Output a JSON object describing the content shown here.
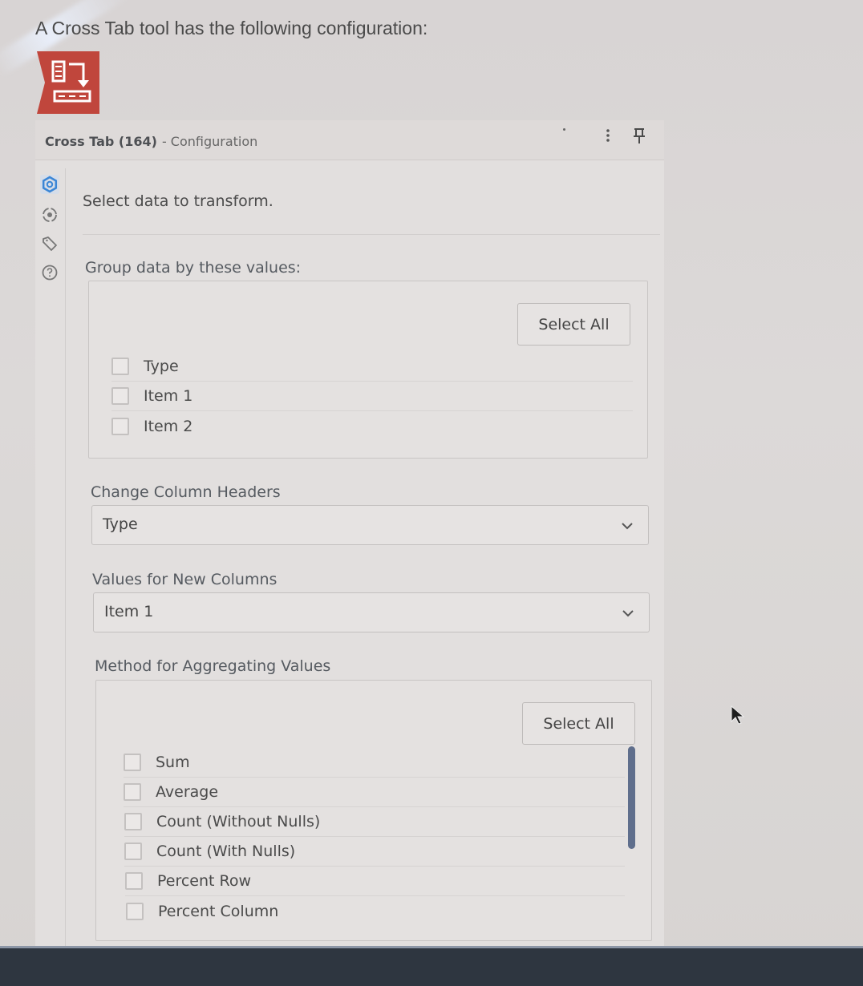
{
  "question": "A Cross Tab tool has the following configuration:",
  "tool_icon": {
    "name": "cross-tab-tool-icon",
    "color": "#c0463c"
  },
  "panel": {
    "title": "Cross Tab (164)",
    "subtitle": "- Configuration",
    "header_icons": [
      "more-options-icon",
      "pin-icon"
    ],
    "rail_icons": [
      {
        "name": "gear-icon",
        "active": true
      },
      {
        "name": "connection-icon",
        "active": false
      },
      {
        "name": "tag-icon",
        "active": false
      },
      {
        "name": "help-icon",
        "active": false
      }
    ],
    "accent_color": "#3b86d6",
    "intro": "Select data to transform.",
    "group_by": {
      "label": "Group data by these values:",
      "select_all": "Select All",
      "items": [
        {
          "label": "Type",
          "checked": false
        },
        {
          "label": "Item 1",
          "checked": false
        },
        {
          "label": "Item 2",
          "checked": false
        }
      ]
    },
    "column_headers": {
      "label": "Change Column Headers",
      "value": "Type"
    },
    "new_column_values": {
      "label": "Values for New Columns",
      "value": "Item 1"
    },
    "aggregation": {
      "label": "Method for Aggregating Values",
      "select_all": "Select All",
      "items": [
        {
          "label": "Sum",
          "checked": false
        },
        {
          "label": "Average",
          "checked": false
        },
        {
          "label": "Count (Without Nulls)",
          "checked": false
        },
        {
          "label": "Count (With Nulls)",
          "checked": false
        },
        {
          "label": "Percent Row",
          "checked": false
        },
        {
          "label": "Percent Column",
          "checked": false
        }
      ]
    }
  }
}
